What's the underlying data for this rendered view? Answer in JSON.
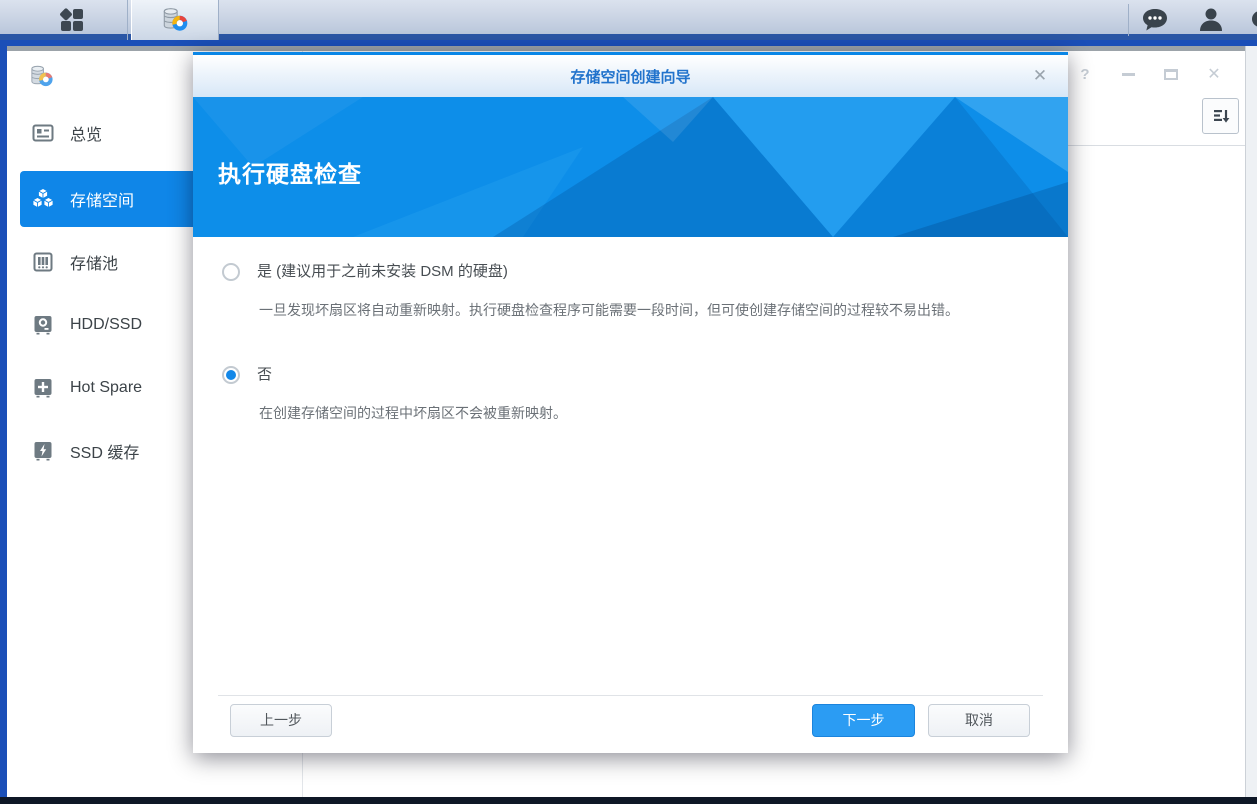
{
  "taskbar": {
    "icons": {
      "main_menu": "grid-icon",
      "storage_manager": "storage-manager-icon",
      "chat": "chat-bubble-icon",
      "user": "person-icon"
    }
  },
  "window": {
    "controls": {
      "help": "?",
      "close": "✕"
    },
    "sidebar": {
      "items": [
        {
          "label": "总览",
          "icon": "overview-icon",
          "active": false
        },
        {
          "label": "存储空间",
          "icon": "volume-cubes-icon",
          "active": true
        },
        {
          "label": "存储池",
          "icon": "storage-pool-icon",
          "active": false
        },
        {
          "label": "HDD/SSD",
          "icon": "hdd-icon",
          "active": false
        },
        {
          "label": "Hot Spare",
          "icon": "hot-spare-icon",
          "active": false
        },
        {
          "label": "SSD 缓存",
          "icon": "ssd-cache-icon",
          "active": false
        }
      ]
    }
  },
  "dialog": {
    "title": "存储空间创建向导",
    "close_label": "✕",
    "banner_title": "执行硬盘检查",
    "options": [
      {
        "label": "是 (建议用于之前未安装 DSM 的硬盘)",
        "description": "一旦发现坏扇区将自动重新映射。执行硬盘检查程序可能需要一段时间，但可使创建存储空间的过程较不易出错。",
        "selected": false
      },
      {
        "label": "否",
        "description": "在创建存储空间的过程中坏扇区不会被重新映射。",
        "selected": true
      }
    ],
    "buttons": {
      "back": "上一步",
      "next": "下一步",
      "cancel": "取消"
    }
  },
  "colors": {
    "accent_blue": "#0f86e8",
    "banner_blue": "#0d8ee9",
    "primary_button": "#2b9cf3",
    "taskbar_top": "#dbe2ee",
    "desktop_left": "#1b4fb8"
  }
}
